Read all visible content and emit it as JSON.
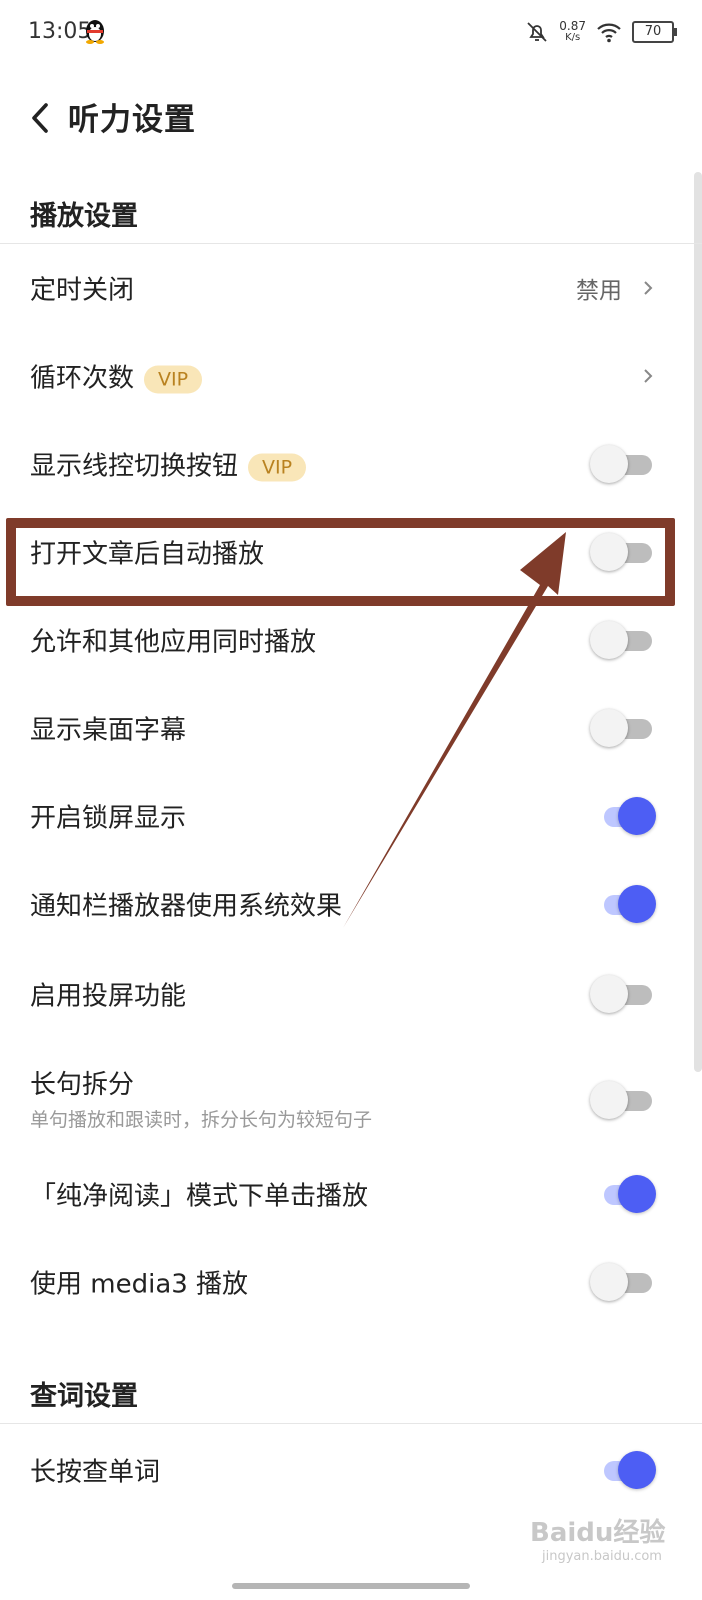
{
  "status": {
    "time": "13:05",
    "net_speed": "0.87",
    "net_unit": "K/s",
    "battery": "70"
  },
  "header": {
    "title": "听力设置"
  },
  "sections": [
    {
      "title": "播放设置"
    },
    {
      "title": "查词设置"
    }
  ],
  "rows": {
    "timer": {
      "label": "定时关闭",
      "value": "禁用"
    },
    "loop": {
      "label": "循环次数",
      "badge": "VIP"
    },
    "wire_buttons": {
      "label": "显示线控切换按钮",
      "badge": "VIP",
      "on": false
    },
    "auto_play": {
      "label": "打开文章后自动播放",
      "on": false
    },
    "allow_other": {
      "label": "允许和其他应用同时播放",
      "on": false
    },
    "desktop_lyrics": {
      "label": "显示桌面字幕",
      "on": false
    },
    "lockscreen": {
      "label": "开启锁屏显示",
      "on": true
    },
    "notif_system": {
      "label": "通知栏播放器使用系统效果",
      "on": true
    },
    "cast": {
      "label": "启用投屏功能",
      "on": false
    },
    "split": {
      "label": "长句拆分",
      "sub": "单句播放和跟读时，拆分长句为较短句子",
      "on": false
    },
    "pure_read": {
      "label": "「纯净阅读」模式下单击播放",
      "on": true
    },
    "media3": {
      "label": "使用 media3 播放",
      "on": false
    },
    "long_press": {
      "label": "长按查单词",
      "on": true
    }
  },
  "watermark": {
    "text": "Baidu经验",
    "sub": "jingyan.baidu.com"
  },
  "colors": {
    "accent": "#4d5ef4",
    "vip_bg": "#f9e6b8",
    "vip_text": "#b98220",
    "annotation": "#7f3b2a"
  }
}
